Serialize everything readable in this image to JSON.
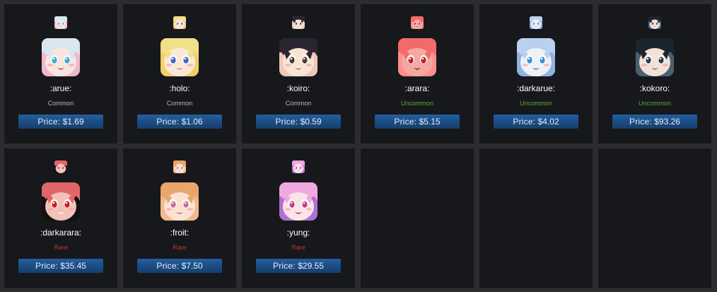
{
  "items": [
    {
      "name": ":arue:",
      "rarity": "Common",
      "price_label": "Price:",
      "price": "$1.69",
      "face": {
        "hair": "#d9e6f0",
        "skin": "#f7e6de",
        "eye": "#3fa7d8",
        "accent": "#f0b8d0",
        "mouth": "#b8354a"
      }
    },
    {
      "name": ":holo:",
      "rarity": "Common",
      "price_label": "Price:",
      "price": "$1.06",
      "face": {
        "hair": "#f1e08a",
        "skin": "#fbe9d8",
        "eye": "#3a69c8",
        "accent": "#f2cf6a",
        "mouth": "#d87a7a"
      }
    },
    {
      "name": ":koiro:",
      "rarity": "Common",
      "price_label": "Price:",
      "price": "$0.59",
      "face": {
        "hair": "#2a2530",
        "skin": "#f8e6d4",
        "eye": "#4a3a3a",
        "accent": "#f2c6b8",
        "mouth": "#c26a6a"
      }
    },
    {
      "name": ":arara:",
      "rarity": "Uncommon",
      "price_label": "Price:",
      "price": "$5.15",
      "face": {
        "hair": "#f26a6a",
        "skin": "#f4a9a0",
        "eye": "#b8202a",
        "accent": "#ff8e8e",
        "mouth": "#7a1a1a"
      }
    },
    {
      "name": ":darkarue:",
      "rarity": "Uncommon",
      "price_label": "Price:",
      "price": "$4.02",
      "face": {
        "hair": "#b9d1ec",
        "skin": "#eef1f6",
        "eye": "#3a8fd8",
        "accent": "#8fb4e0",
        "mouth": "#8a5a6a"
      }
    },
    {
      "name": ":kokoro:",
      "rarity": "Uncommon",
      "price_label": "Price:",
      "price": "$93.26",
      "face": {
        "hair": "#1c2430",
        "skin": "#f3e1d8",
        "eye": "#2a3a4a",
        "accent": "#4a6070",
        "mouth": "#a25a5a"
      }
    },
    {
      "name": ":darkarara:",
      "rarity": "Rare",
      "price_label": "Price:",
      "price": "$35.45",
      "face": {
        "hair": "#e0666a",
        "skin": "#f2c2b8",
        "eye": "#d21a1a",
        "accent": "#111111",
        "mouth": "#ffffff"
      }
    },
    {
      "name": ":froit:",
      "rarity": "Rare",
      "price_label": "Price:",
      "price": "$7.50",
      "face": {
        "hair": "#e8a66a",
        "skin": "#fbe2d2",
        "eye": "#c46a9a",
        "accent": "#f2b98a",
        "mouth": "#c25a6a"
      }
    },
    {
      "name": ":yung:",
      "rarity": "Rare",
      "price_label": "Price:",
      "price": "$29.55",
      "face": {
        "hair": "#f0a8e0",
        "skin": "#fae4e8",
        "eye": "#c83a8a",
        "accent": "#b070d0",
        "mouth": "#9a2a4a"
      }
    }
  ],
  "colors": {
    "background": "#2b2c30",
    "card": "#16181c",
    "common": "#b8b8b8",
    "uncommon": "#5fa83a",
    "rare": "#b83b2c",
    "button": "#1c4f86"
  }
}
